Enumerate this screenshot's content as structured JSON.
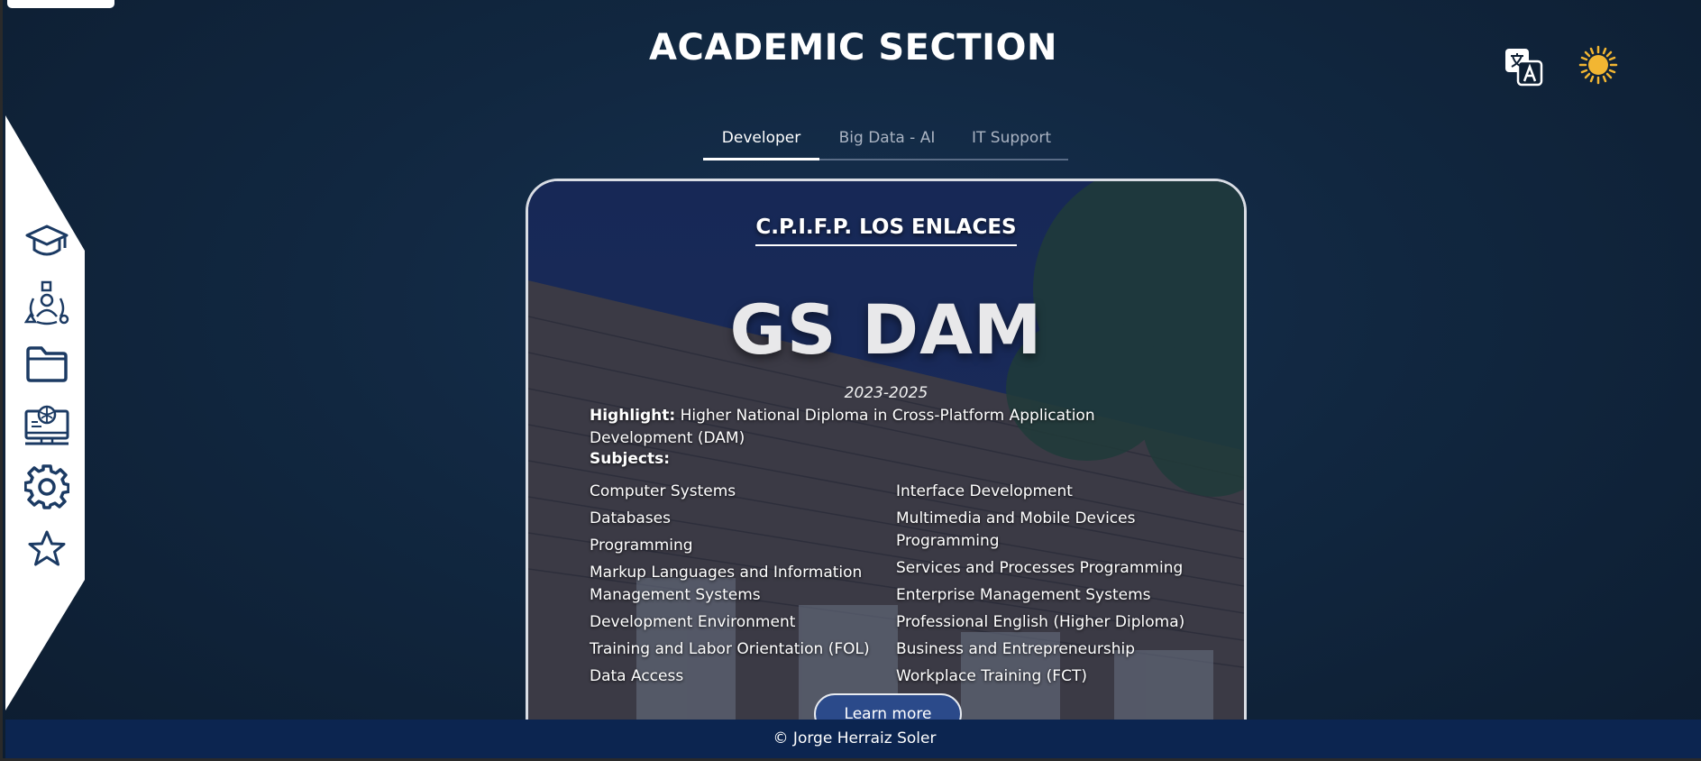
{
  "page": {
    "title": "ACADEMIC SECTION"
  },
  "header_icons": [
    {
      "name": "translate-icon"
    },
    {
      "name": "sun-icon",
      "color": "#f2b632"
    }
  ],
  "sidebar": {
    "items": [
      {
        "name": "graduation-cap-icon"
      },
      {
        "name": "team-network-icon"
      },
      {
        "name": "folder-icon"
      },
      {
        "name": "computer-monitor-icon"
      },
      {
        "name": "gear-icon"
      },
      {
        "name": "star-icon"
      }
    ],
    "icon_color": "#1b3a63"
  },
  "tabs": [
    {
      "label": "Developer",
      "active": true
    },
    {
      "label": "Big Data - AI",
      "active": false
    },
    {
      "label": "IT Support",
      "active": false
    }
  ],
  "card": {
    "school": "C.P.I.F.P. LOS ENLACES",
    "degree": "GS DAM",
    "years": "2023-2025",
    "highlight_label": "Highlight:",
    "highlight_text": "Higher National Diploma in Cross-Platform Application Development (DAM)",
    "subjects_label": "Subjects:",
    "subjects_left": [
      "Computer Systems",
      "Databases",
      "Programming",
      "Markup Languages and Information Management Systems",
      "Development Environment",
      "Training and Labor Orientation (FOL)",
      "Data Access"
    ],
    "subjects_right": [
      "Interface Development",
      "Multimedia and Mobile Devices Programming",
      "Services and Processes Programming",
      "Enterprise Management Systems",
      "Professional English (Higher Diploma)",
      "Business and Entrepreneurship",
      "Workplace Training (FCT)"
    ],
    "button_label": "Learn more"
  },
  "footer": {
    "text": "© Jorge Herraiz Soler"
  },
  "colors": {
    "background": "#112740",
    "footer": "#0c2550",
    "button": "#2b4a8a"
  }
}
